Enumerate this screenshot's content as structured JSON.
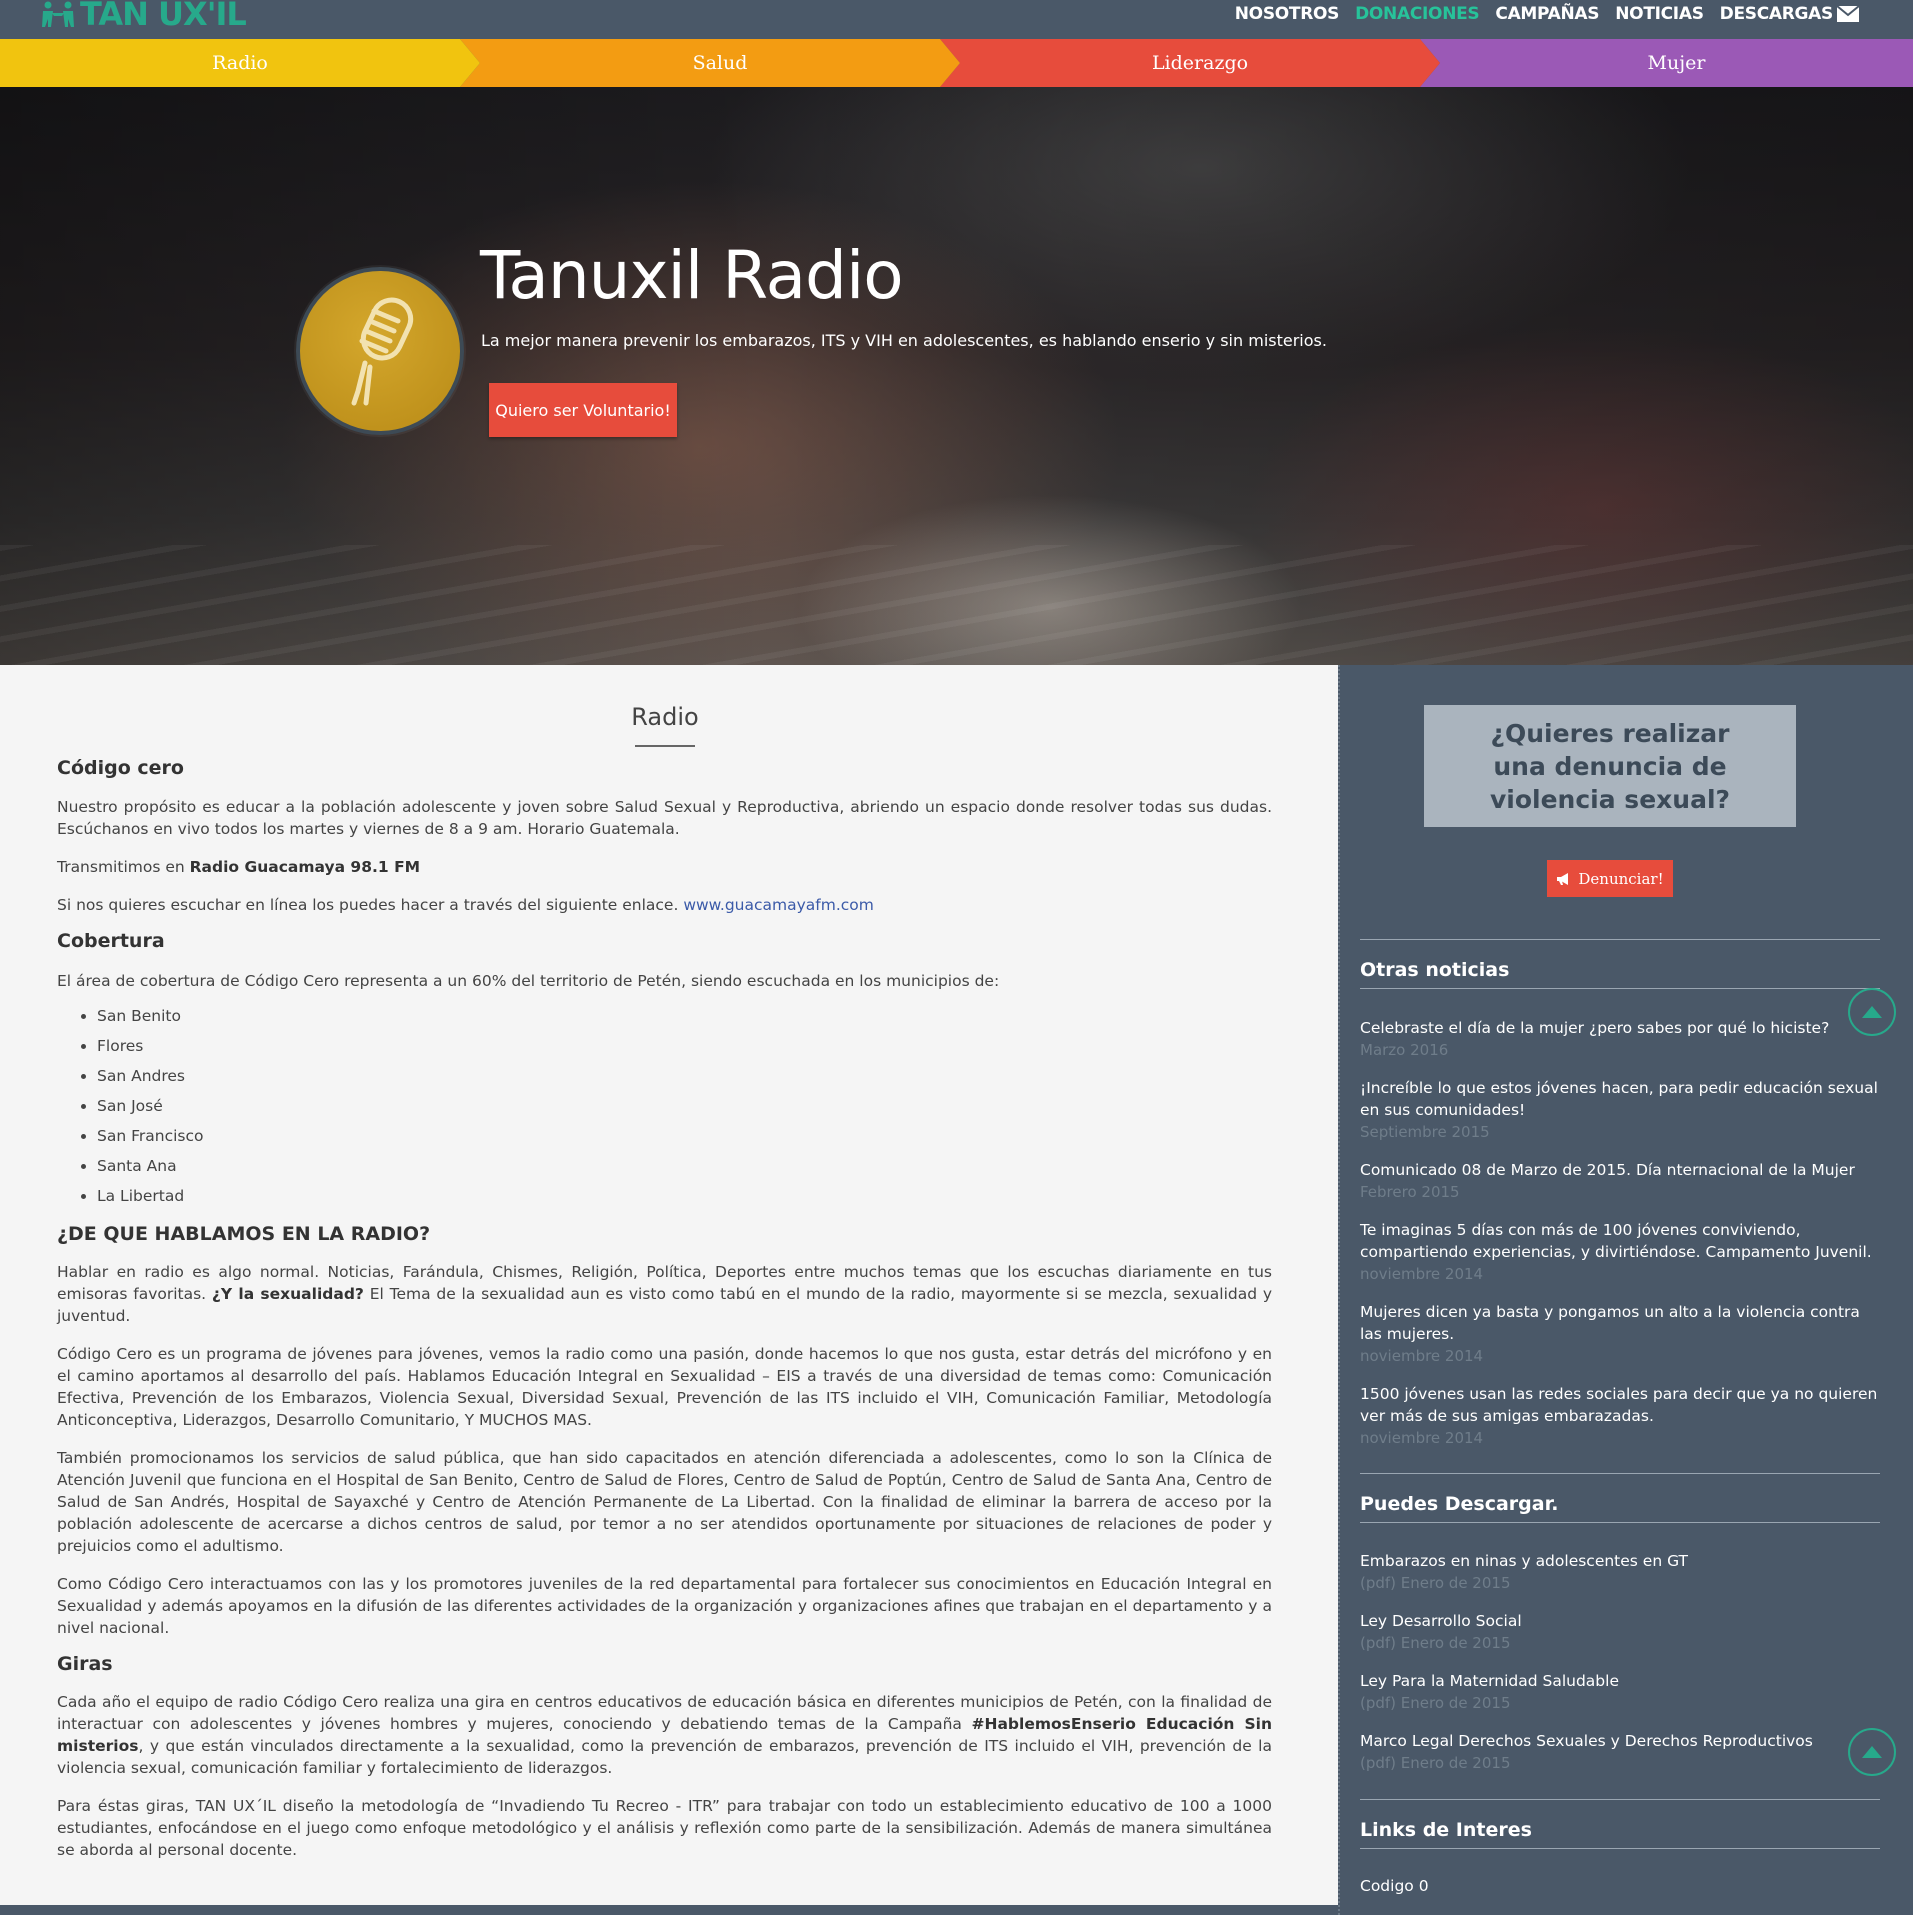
{
  "header": {
    "logo_text": "TAN UX'IL",
    "nav": [
      "NOSOTROS",
      "DONACIONES",
      "CAMPAÑAS",
      "NOTICIAS",
      "DESCARGAS"
    ]
  },
  "categories": [
    "Radio",
    "Salud",
    "Liderazgo",
    "Mujer"
  ],
  "hero": {
    "title": "Tanuxil Radio",
    "subtitle": "La mejor manera prevenir los embarazos, ITS y VIH en adolescentes, es hablando enserio y sin misterios.",
    "button": "Quiero ser Voluntario!"
  },
  "main": {
    "title": "Radio",
    "codigo_title": "Código cero",
    "codigo_p1": "Nuestro propósito es educar a la población adolescente y joven sobre Salud Sexual y Reproductiva, abriendo un espacio donde resolver todas sus dudas. Escúchanos en vivo todos los martes y viernes de 8 a 9 am. Horario Guatemala.",
    "trans_pre": "Transmitimos en ",
    "trans_bold": "Radio Guacamaya 98.1 FM",
    "online_pre": "Si nos quieres escuchar en línea los puedes hacer a través del siguiente enlace. ",
    "online_link": "www.guacamayafm.com",
    "cobertura_title": "Cobertura",
    "cobertura_p": "El área de cobertura de Código Cero representa a un 60% del territorio de Petén, siendo escuchada en los municipios de:",
    "municipios": [
      "San Benito",
      "Flores",
      "San Andres",
      "San José",
      "San Francisco",
      "Santa Ana",
      "La Libertad"
    ],
    "hablamos_title": "¿DE QUE HABLAMOS EN LA RADIO?",
    "hablamos_p1_pre": "Hablar en radio es algo normal. Noticias, Farándula, Chismes, Religión, Política, Deportes entre muchos temas que los escuchas diariamente en tus emisoras favoritas. ",
    "hablamos_p1_bold": "¿Y la sexualidad?",
    "hablamos_p1_post": " El Tema de la sexualidad aun es visto como tabú en el mundo de la radio, mayormente si se mezcla, sexualidad y juventud.",
    "hablamos_p2": "Código Cero es un programa de jóvenes para jóvenes, vemos la radio como una pasión, donde hacemos lo que nos gusta, estar detrás del micrófono y en el camino aportamos al desarrollo del país. Hablamos Educación Integral en Sexualidad – EIS a través de una diversidad de temas como: Comunicación Efectiva, Prevención de los Embarazos, Violencia Sexual, Diversidad Sexual, Prevención de las ITS incluido el VIH, Comunicación Familiar, Metodología Anticonceptiva, Liderazgos, Desarrollo Comunitario, Y MUCHOS MAS.",
    "hablamos_p3": "También promocionamos los servicios de salud pública, que han sido capacitados en atención diferenciada a adolescentes, como lo son la Clínica de Atención Juvenil que funciona en el Hospital de San Benito, Centro de Salud de Flores, Centro de Salud de Poptún, Centro de Salud de Santa Ana, Centro de Salud de San Andrés, Hospital de Sayaxché y Centro de Atención Permanente de La Libertad. Con la finalidad de eliminar la barrera de acceso por la población adolescente de acercarse a dichos centros de salud, por temor a no ser atendidos oportunamente por situaciones de relaciones de poder y prejuicios como el adultismo.",
    "hablamos_p4": "Como Código Cero interactuamos con las y los promotores juveniles de la red departamental para fortalecer sus conocimientos en Educación Integral en Sexualidad y además apoyamos en la difusión de las diferentes actividades de la organización y organizaciones afines que trabajan en el departamento y a nivel nacional.",
    "giras_title": "Giras",
    "giras_p1_pre": "Cada año el equipo de radio Código Cero realiza una gira en centros educativos de educación básica en diferentes municipios de Petén, con la finalidad de interactuar con adolescentes y jóvenes hombres y mujeres, conociendo y debatiendo temas de la Campaña ",
    "giras_p1_bold": "#HablemosEnserio Educación Sin misterios",
    "giras_p1_post": ", y que están vinculados directamente a la sexualidad, como la prevención de embarazos, prevención de ITS incluido el VIH, prevención de la violencia sexual, comunicación familiar y fortalecimiento de liderazgos.",
    "giras_p2": "Para éstas giras, TAN UX´IL diseño la metodología de “Invadiendo Tu Recreo - ITR” para trabajar con todo un establecimiento educativo de 100 a 1000 estudiantes, enfocándose en el juego como enfoque metodológico y el análisis y reflexión como parte de la sensibilización. Además de manera simultánea se aborda al personal docente."
  },
  "sidebar": {
    "denuncia_text": "¿Quieres realizar una denuncia de violencia sexual?",
    "denuncia_button": "Denunciar!",
    "noticias_title": "Otras noticias",
    "noticias": [
      {
        "title": "Celebraste el día de la mujer ¿pero sabes por qué lo hiciste?",
        "date": "Marzo 2016"
      },
      {
        "title": "¡Increíble lo que estos jóvenes hacen, para pedir educación sexual en sus comunidades!",
        "date": "Septiembre 2015"
      },
      {
        "title": "Comunicado 08 de Marzo de 2015. Día nternacional de la Mujer",
        "date": "Febrero 2015"
      },
      {
        "title": "Te imaginas 5 días con más de 100 jóvenes conviviendo, compartiendo experiencias, y divirtiéndose. Campamento Juvenil.",
        "date": "noviembre 2014"
      },
      {
        "title": "Mujeres dicen ya basta y pongamos un alto a la violencia contra las mujeres.",
        "date": "noviembre 2014"
      },
      {
        "title": "1500 jóvenes usan las redes sociales para decir que ya no quieren ver más de sus amigas embarazadas.",
        "date": "noviembre 2014"
      }
    ],
    "descargas_title": "Puedes Descargar.",
    "descargas": [
      {
        "title": "Embarazos en ninas y adolescentes en GT",
        "date": "(pdf) Enero de 2015"
      },
      {
        "title": "Ley Desarrollo Social",
        "date": "(pdf) Enero de 2015"
      },
      {
        "title": "Ley Para la Maternidad Saludable",
        "date": "(pdf) Enero de 2015"
      },
      {
        "title": "Marco Legal Derechos Sexuales y Derechos Reproductivos",
        "date": "(pdf) Enero de 2015"
      }
    ],
    "links_title": "Links de Interes",
    "links": [
      "Codigo 0"
    ]
  },
  "colors": {
    "brand_green": "#27a98b",
    "radio": "#f1c40f",
    "salud": "#f39c12",
    "liderazgo": "#e74c3c",
    "mujer": "#9b59b6",
    "sidebar_bg": "#4a5868"
  }
}
